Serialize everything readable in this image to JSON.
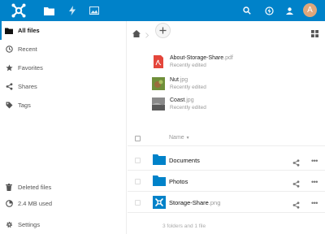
{
  "topbar": {
    "bg_color": "#0082c9",
    "icons": [
      "nextcloud-logo",
      "folder-icon",
      "activity-icon",
      "gallery-icon",
      "search-icon",
      "notifications-icon",
      "contacts-icon"
    ],
    "avatar_letter": "A"
  },
  "sidebar": {
    "items": [
      {
        "label": "All files",
        "icon": "folder-icon",
        "active": true
      },
      {
        "label": "Recent",
        "icon": "clock-icon"
      },
      {
        "label": "Favorites",
        "icon": "star-icon"
      },
      {
        "label": "Shares",
        "icon": "share-icon"
      },
      {
        "label": "Tags",
        "icon": "tag-icon"
      }
    ],
    "deleted_files": "Deleted files",
    "storage_used": "2.4 MB used",
    "settings": "Settings"
  },
  "recent": [
    {
      "name": "About-Storage-Share",
      "ext": ".pdf",
      "sub": "Recently edited",
      "icon": "pdf-icon"
    },
    {
      "name": "Nut",
      "ext": ".jpg",
      "sub": "Recently edited",
      "icon": "image-thumb"
    },
    {
      "name": "Coast",
      "ext": ".jpg",
      "sub": "Recently edited",
      "icon": "image-thumb"
    }
  ],
  "table": {
    "column_name": "Name",
    "rows": [
      {
        "name": "Documents",
        "ext": "",
        "type": "folder"
      },
      {
        "name": "Photos",
        "ext": "",
        "type": "folder"
      },
      {
        "name": "Storage-Share",
        "ext": ".png",
        "type": "image"
      }
    ],
    "summary": "3 folders and 1 file"
  }
}
